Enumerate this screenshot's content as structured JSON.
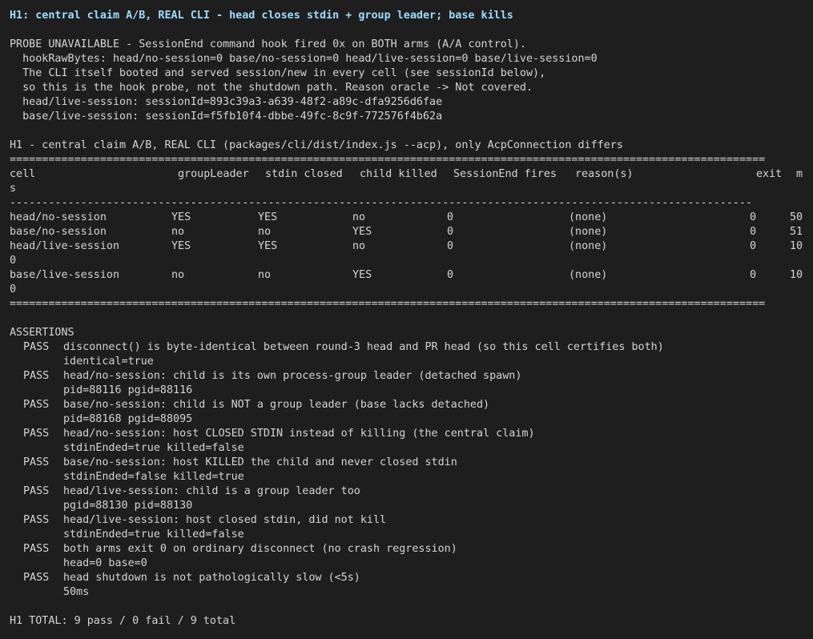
{
  "title": "H1: central claim A/B, REAL CLI - head closes stdin + group leader; base kills",
  "probe": {
    "line1": "PROBE UNAVAILABLE - SessionEnd command hook fired 0x on BOTH arms (A/A control).",
    "line2": "  hookRawBytes: head/no-session=0 base/no-session=0 head/live-session=0 base/live-session=0",
    "line3": "  The CLI itself booted and served session/new in every cell (see sessionId below),",
    "line4": "  so this is the hook probe, not the shutdown path. Reason oracle -> Not covered.",
    "line5": "  head/live-session: sessionId=893c39a3-a639-48f2-a89c-dfa9256d6fae",
    "line6": "  base/live-session: sessionId=f5fb10f4-dbbe-49fc-8c9f-772576f4b62a"
  },
  "table": {
    "caption": "H1 - central claim A/B, REAL CLI (packages/cli/dist/index.js --acp), only AcpConnection differs",
    "rule_double": "=====================================================================================================================",
    "rule_single": "-------------------------------------------------------------------------------------------------------------------",
    "headers": {
      "cell": "cell",
      "groupLeader": "groupLeader",
      "stdinClosed": "stdin closed",
      "childKilled": "child killed",
      "sessionEnd": "SessionEnd fires",
      "reasons": "reason(s)",
      "exit": "exit",
      "ms": "m",
      "ms_wrap": "s"
    },
    "rows": [
      {
        "cell": "head/no-session",
        "groupLeader": "YES",
        "stdinClosed": "YES",
        "childKilled": "no",
        "sessionEnd": "0",
        "reasons": "(none)",
        "exit": "0",
        "ms": "50",
        "ms_wrap": ""
      },
      {
        "cell": "base/no-session",
        "groupLeader": "no",
        "stdinClosed": "no",
        "childKilled": "YES",
        "sessionEnd": "0",
        "reasons": "(none)",
        "exit": "0",
        "ms": "51",
        "ms_wrap": ""
      },
      {
        "cell": "head/live-session",
        "groupLeader": "YES",
        "stdinClosed": "YES",
        "childKilled": "no",
        "sessionEnd": "0",
        "reasons": "(none)",
        "exit": "0",
        "ms": "10",
        "ms_wrap": "0"
      },
      {
        "cell": "base/live-session",
        "groupLeader": "no",
        "stdinClosed": "no",
        "childKilled": "YES",
        "sessionEnd": "0",
        "reasons": "(none)",
        "exit": "0",
        "ms": "10",
        "ms_wrap": "0"
      }
    ]
  },
  "assertions": {
    "heading": "ASSERTIONS",
    "items": [
      {
        "status": "PASS",
        "text": "disconnect() is byte-identical between round-3 head and PR head (so this cell certifies both)",
        "detail": "identical=true"
      },
      {
        "status": "PASS",
        "text": "head/no-session: child is its own process-group leader (detached spawn)",
        "detail": "pid=88116 pgid=88116"
      },
      {
        "status": "PASS",
        "text": "base/no-session: child is NOT a group leader (base lacks detached)",
        "detail": "pid=88168 pgid=88095"
      },
      {
        "status": "PASS",
        "text": "head/no-session: host CLOSED STDIN instead of killing (the central claim)",
        "detail": "stdinEnded=true killed=false"
      },
      {
        "status": "PASS",
        "text": "base/no-session: host KILLED the child and never closed stdin",
        "detail": "stdinEnded=false killed=true"
      },
      {
        "status": "PASS",
        "text": "head/live-session: child is a group leader too",
        "detail": "pgid=88130 pid=88130"
      },
      {
        "status": "PASS",
        "text": "head/live-session: host closed stdin, did not kill",
        "detail": "stdinEnded=true killed=false"
      },
      {
        "status": "PASS",
        "text": "both arms exit 0 on ordinary disconnect (no crash regression)",
        "detail": "head=0 base=0"
      },
      {
        "status": "PASS",
        "text": "head shutdown is not pathologically slow (<5s)",
        "detail": "50ms"
      }
    ]
  },
  "total": "H1 TOTAL: 9 pass / 0 fail / 9 total",
  "colors": {
    "background": "#1e1e1e",
    "foreground": "#d4d4d4",
    "title": "#9cdcfe"
  }
}
